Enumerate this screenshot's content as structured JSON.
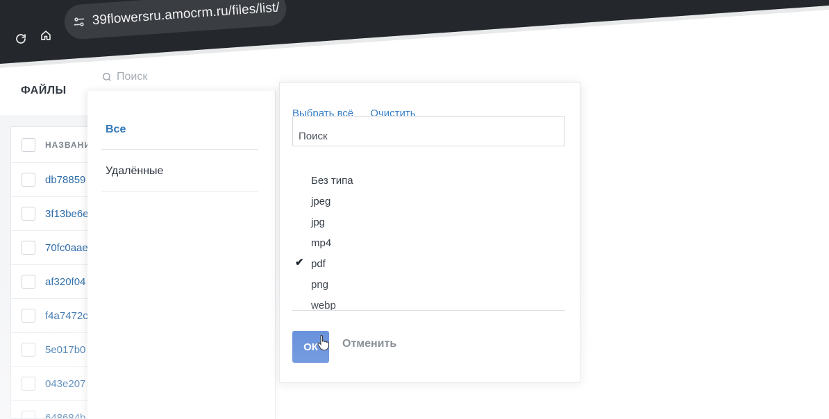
{
  "browser": {
    "url": "39flowersru.amocrm.ru/files/list/"
  },
  "app": {
    "title": "ФАЙЛЫ",
    "search_placeholder": "Поиск"
  },
  "file_table": {
    "column_header": "НАЗВАНИ",
    "rows": [
      "db78859",
      "3f13be6e",
      "70fc0aae",
      "af320f04",
      "f4a7472c",
      "5e017b0",
      "043e207",
      "648684b"
    ]
  },
  "filter_panel": {
    "items": [
      {
        "label": "Все",
        "active": true
      },
      {
        "label": "Удалённые",
        "active": false
      }
    ]
  },
  "type_dropdown": {
    "select_all_label": "Выбрать всё",
    "clear_label": "Очистить",
    "search_placeholder": "Поиск",
    "options": [
      {
        "label": "Без типа",
        "checked": false
      },
      {
        "label": "jpeg",
        "checked": false
      },
      {
        "label": "jpg",
        "checked": false
      },
      {
        "label": "mp4",
        "checked": false
      },
      {
        "label": "pdf",
        "checked": true
      },
      {
        "label": "png",
        "checked": false
      },
      {
        "label": "webp",
        "checked": false
      }
    ],
    "ok_label": "ОК",
    "cancel_label": "Отменить"
  },
  "colors": {
    "accent": "#4e7fd6",
    "link": "#3a80c8",
    "chrome": "#24272b"
  }
}
